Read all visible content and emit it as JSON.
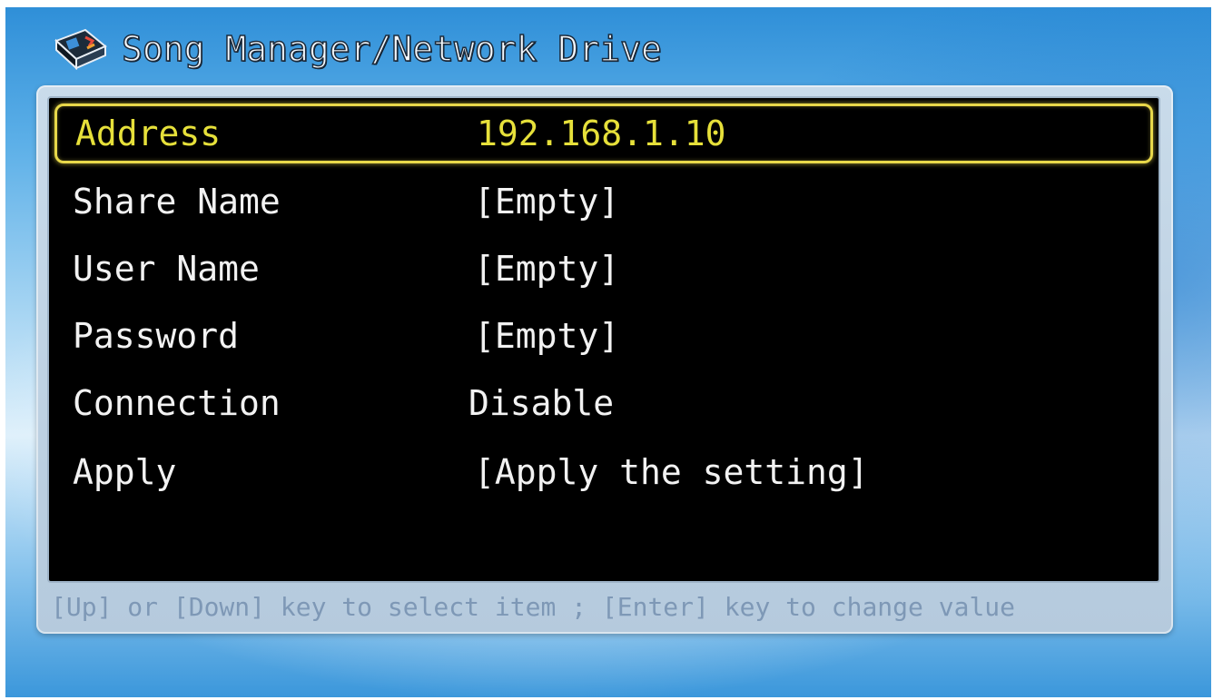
{
  "window": {
    "title": "Song Manager/Network Drive",
    "icon": "network-drive-icon"
  },
  "settings": {
    "rows": [
      {
        "label": "Address",
        "value": "192.168.1.10",
        "selected": true
      },
      {
        "label": "Share Name",
        "value": "[Empty]",
        "selected": false
      },
      {
        "label": "User Name",
        "value": "[Empty]",
        "selected": false
      },
      {
        "label": "Password",
        "value": "[Empty]",
        "selected": false
      },
      {
        "label": "Connection",
        "value": "Disable",
        "selected": false
      },
      {
        "label": "Apply",
        "value": "[Apply the setting]",
        "selected": false
      }
    ]
  },
  "footer": {
    "hint": "[Up] or [Down] key to select item ; [Enter] key to change value"
  },
  "colors": {
    "selected_text": "#e6e03a",
    "selected_border": "#e8d84a",
    "normal_text": "#f2f2f2",
    "list_background": "#000000",
    "hint_text": "#7e98b6"
  }
}
